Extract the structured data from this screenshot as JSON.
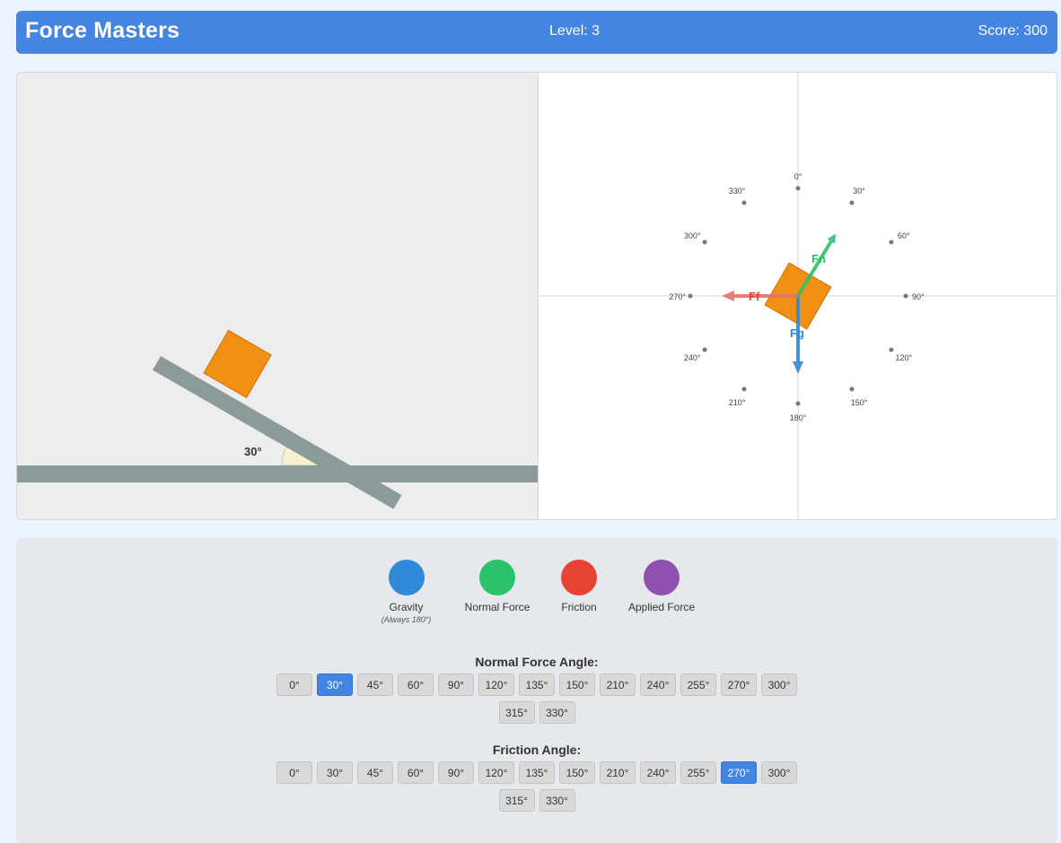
{
  "header": {
    "title": "Force Masters",
    "level": "Level: 3",
    "score": "Score: 300"
  },
  "scene": {
    "incline_angle_label": "30°"
  },
  "fbd": {
    "compass_labels": [
      "0°",
      "30°",
      "60°",
      "90°",
      "120°",
      "150°",
      "180°",
      "210°",
      "240°",
      "270°",
      "300°",
      "330°"
    ],
    "vectors": {
      "gravity": {
        "label": "Fg",
        "angle_deg": 180,
        "color": "#2f8ad8"
      },
      "normal": {
        "label": "Fn",
        "angle_deg": 30,
        "color": "#2bc36a"
      },
      "friction": {
        "label": "Ff",
        "angle_deg": 270,
        "color": "#e8726a"
      }
    }
  },
  "legend": [
    {
      "label": "Gravity",
      "sub": "(Always 180°)",
      "color": "#2f8ad8"
    },
    {
      "label": "Normal Force",
      "sub": "",
      "color": "#2bc36a"
    },
    {
      "label": "Friction",
      "sub": "",
      "color": "#e74334"
    },
    {
      "label": "Applied Force",
      "sub": "",
      "color": "#8f50b0"
    }
  ],
  "normal_force": {
    "title": "Normal Force Angle:",
    "options": [
      "0°",
      "30°",
      "45°",
      "60°",
      "90°",
      "120°",
      "135°",
      "150°",
      "210°",
      "240°",
      "255°",
      "270°",
      "300°",
      "315°",
      "330°"
    ],
    "selected": "30°"
  },
  "friction": {
    "title": "Friction Angle:",
    "options": [
      "0°",
      "30°",
      "45°",
      "60°",
      "90°",
      "120°",
      "135°",
      "150°",
      "210°",
      "240°",
      "255°",
      "270°",
      "300°",
      "315°",
      "330°"
    ],
    "selected": "270°"
  }
}
